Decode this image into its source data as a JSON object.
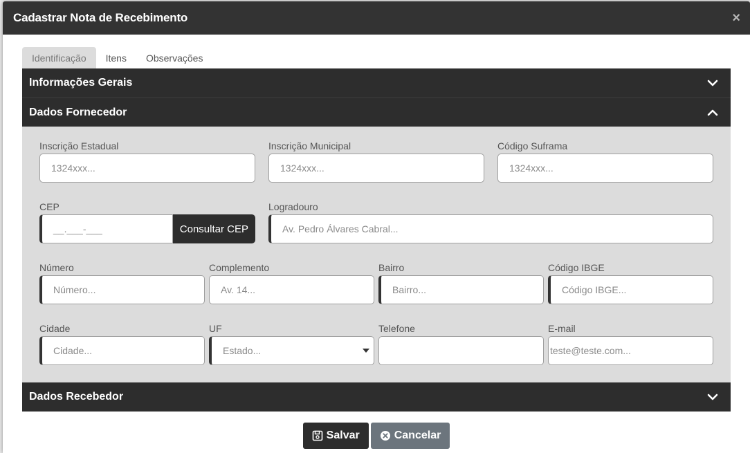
{
  "modal": {
    "title": "Cadastrar Nota de Recebimento",
    "close_label": "×"
  },
  "tabs": [
    {
      "label": "Identificação",
      "active": true
    },
    {
      "label": "Itens",
      "active": false
    },
    {
      "label": "Observações",
      "active": false
    }
  ],
  "sections": {
    "informacoes_gerais": {
      "title": "Informações Gerais",
      "expanded": false
    },
    "dados_fornecedor": {
      "title": "Dados Fornecedor",
      "expanded": true
    },
    "dados_recebedor": {
      "title": "Dados Recebedor",
      "expanded": false
    }
  },
  "fields": {
    "inscricao_estadual": {
      "label": "Inscrição Estadual",
      "placeholder": "1324xxx..."
    },
    "inscricao_municipal": {
      "label": "Inscrição Municipal",
      "placeholder": "1324xxx..."
    },
    "codigo_suframa": {
      "label": "Código Suframa",
      "placeholder": "1324xxx..."
    },
    "cep": {
      "label": "CEP",
      "placeholder": "__.___-___",
      "button": "Consultar CEP"
    },
    "logradouro": {
      "label": "Logradouro",
      "placeholder": "Av. Pedro Álvares Cabral..."
    },
    "numero": {
      "label": "Número",
      "placeholder": "Número..."
    },
    "complemento": {
      "label": "Complemento",
      "placeholder": "Av. 14..."
    },
    "bairro": {
      "label": "Bairro",
      "placeholder": "Bairro..."
    },
    "codigo_ibge": {
      "label": "Código IBGE",
      "placeholder": "Código IBGE..."
    },
    "cidade": {
      "label": "Cidade",
      "placeholder": "Cidade..."
    },
    "uf": {
      "label": "UF",
      "selected": "Estado..."
    },
    "telefone": {
      "label": "Telefone",
      "placeholder": ""
    },
    "email": {
      "label": "E-mail",
      "placeholder": "teste@teste.com..."
    }
  },
  "footer": {
    "save_label": "Salvar",
    "cancel_label": "Cancelar"
  },
  "colors": {
    "header_dark": "#333333",
    "panel_bg": "#dcdcdc",
    "cancel_gray": "#6c757d"
  }
}
